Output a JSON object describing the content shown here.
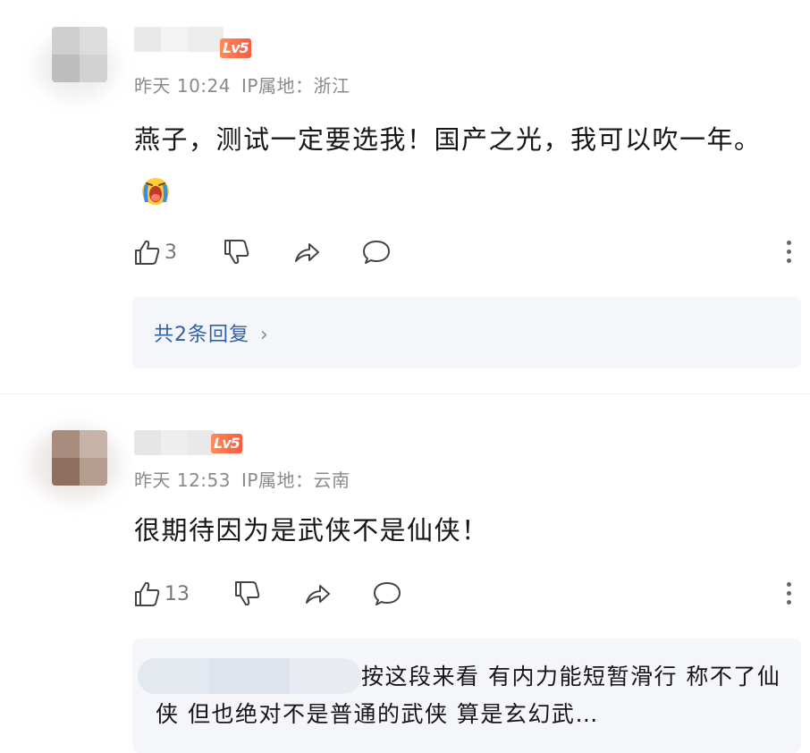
{
  "comments": [
    {
      "badge": "Lv5",
      "time": "昨天 10:24",
      "ip_label": "IP属地：",
      "ip_region": "浙江",
      "text": "燕子，测试一定要选我！国产之光，我可以吹一年。",
      "emoji": "crying-face-emoji",
      "likes": "3",
      "replies_label": "共2条回复",
      "replies_chevron": "›"
    },
    {
      "badge": "Lv5",
      "time": "昨天 12:53",
      "ip_label": "IP属地：",
      "ip_region": "云南",
      "text": "很期待因为是武侠不是仙侠！",
      "likes": "13",
      "reply_preview": "按这段来看 有内力能短暂滑行 称不了仙侠 但也绝对不是普通的武侠 算是玄幻武…"
    }
  ],
  "icons": {
    "like": "thumbs-up-icon",
    "dislike": "thumbs-down-icon",
    "share": "share-icon",
    "comment": "comment-bubble-icon",
    "more": "more-vertical-icon"
  },
  "colors": {
    "badge": "#ff6a45",
    "link": "#2f5fa8",
    "meta": "#8a8a8a",
    "reply_bg": "#f5f6f9"
  }
}
